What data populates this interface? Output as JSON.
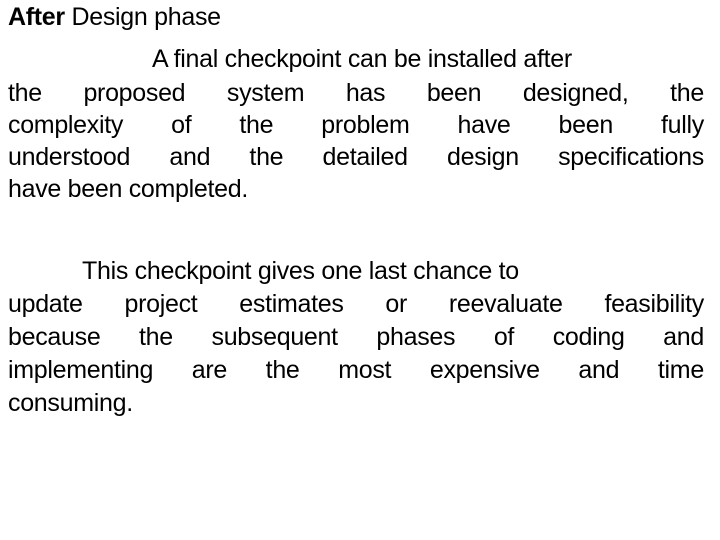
{
  "heading": {
    "bold": "After",
    "rest": " Design phase"
  },
  "paragraph1": {
    "lines": [
      "A final checkpoint can be installed after",
      [
        "the",
        "proposed",
        "system",
        "has",
        "been",
        "designed,",
        "the"
      ],
      [
        "complexity",
        "of",
        "the",
        "problem",
        "have",
        "been",
        "fully"
      ],
      [
        "understood",
        "and",
        "the",
        "detailed",
        "design",
        "specifications"
      ],
      "have been completed."
    ]
  },
  "paragraph2": {
    "lines": [
      "This checkpoint gives one last chance to",
      [
        "update",
        "project",
        "estimates",
        "or",
        "reevaluate",
        "feasibility"
      ],
      [
        "because",
        "the",
        "subsequent",
        "phases",
        "of",
        "coding",
        "and"
      ],
      [
        "implementing",
        "are",
        "the",
        "most",
        "expensive",
        "and",
        "time"
      ],
      "consuming."
    ]
  }
}
